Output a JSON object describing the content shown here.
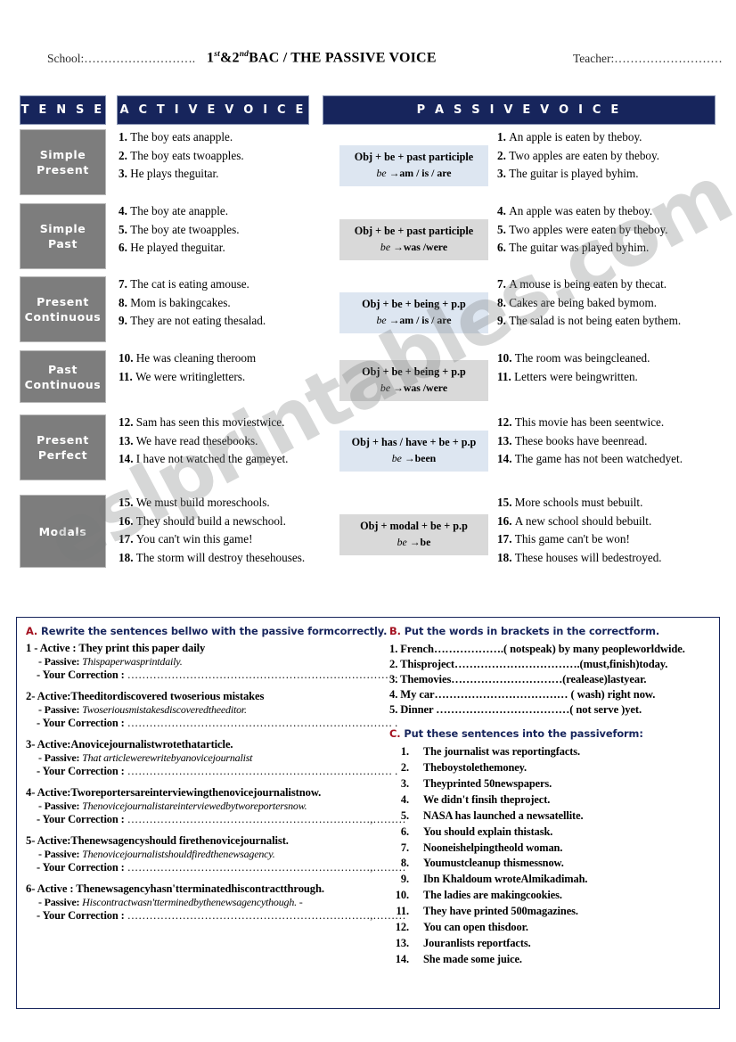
{
  "header": {
    "school_label": "School:……………………….",
    "teacher_label": "Teacher:………………………",
    "title_pre": "1",
    "title_sup1": "st",
    "title_mid": "&2",
    "title_sup2": "nd",
    "title_post": "BAC / THE PASSIVE VOICE",
    "title_plain": "1st&2ndBAC / THE PASSIVE VOICE"
  },
  "columns": {
    "tense": "T E N S E",
    "active": "A C T I V E   V O I C E",
    "passive": "P A S S I V E   V O I C E"
  },
  "colors": {
    "header_navy": "#17255c",
    "tense_gray": "#7d7d7d",
    "formula_blue": "#dde6f1",
    "formula_gray": "#d9d9d9",
    "accent_red": "#a3101f"
  },
  "rows": [
    {
      "tense": "Simple Present",
      "tense_line1": "Simple",
      "tense_line2": "Present",
      "formula_style": "blue",
      "formula_line1": "Obj + be + past participle",
      "formula_line2_pre": "be",
      "formula_line2_post": "am / is / are",
      "active": [
        {
          "n": "1.",
          "text": "The boy  eats anapple."
        },
        {
          "n": "2.",
          "text": "The boy  eats twoapples."
        },
        {
          "n": "3.",
          "text": "He plays  theguitar."
        }
      ],
      "passive": [
        {
          "n": "1.",
          "text": "An apple is eaten by theboy."
        },
        {
          "n": "2.",
          "text": "Two apples are eaten by theboy."
        },
        {
          "n": "3.",
          "text": "The guitar is played byhim."
        }
      ]
    },
    {
      "tense": "Simple Past",
      "tense_line1": "Simple",
      "tense_line2": "Past",
      "formula_style": "gray",
      "formula_line1": "Obj + be + past participle",
      "formula_line2_pre": "be",
      "formula_line2_post": "was /were",
      "active": [
        {
          "n": "4.",
          "text": "The boy  ate anapple."
        },
        {
          "n": "5.",
          "text": "The boy ate twoapples."
        },
        {
          "n": "6.",
          "text": "He  played theguitar."
        }
      ],
      "passive": [
        {
          "n": "4.",
          "text": "An apple was eaten by theboy."
        },
        {
          "n": "5.",
          "text": "Two apples were eaten by theboy."
        },
        {
          "n": "6.",
          "text": "The guitar was played byhim."
        }
      ]
    },
    {
      "tense": "Present Continuous",
      "tense_line1": "Present",
      "tense_line2": "Continuous",
      "formula_style": "blue",
      "formula_line1": "Obj + be + being + p.p",
      "formula_line2_pre": "be",
      "formula_line2_post": "am / is / are",
      "active": [
        {
          "n": "7.",
          "text": "The cat is eating amouse."
        },
        {
          "n": "8.",
          "text": "Mom  is bakingcakes."
        },
        {
          "n": "9.",
          "text": "They  are not eating thesalad."
        }
      ],
      "passive": [
        {
          "n": "7.",
          "text": "A mouse is being  eaten by thecat."
        },
        {
          "n": "8.",
          "text": "Cakes are being baked bymom."
        },
        {
          "n": "9.",
          "text": "The salad  is not being eaten bythem."
        }
      ]
    },
    {
      "tense": "Past Continuous",
      "tense_line1": "Past",
      "tense_line2": "Continuous",
      "formula_style": "gray",
      "formula_line1": "Obj + be + being + p.p",
      "formula_line2_pre": "be",
      "formula_line2_post": "was /were",
      "active": [
        {
          "n": "10.",
          "text": "He  was cleaning theroom"
        },
        {
          "n": "11.",
          "text": "We were writingletters."
        }
      ],
      "passive": [
        {
          "n": "10.",
          "text": "The room was beingcleaned."
        },
        {
          "n": "11.",
          "text": "Letters were beingwritten."
        }
      ]
    },
    {
      "tense": "Present Perfect",
      "tense_line1": "Present",
      "tense_line2": "Perfect",
      "formula_style": "blue",
      "formula_line1": "Obj + has / have + be + p.p",
      "formula_line2_pre": "be",
      "formula_line2_post": "been",
      "active": [
        {
          "n": "12.",
          "text": "Sam has seen this  moviestwice."
        },
        {
          "n": "13.",
          "text": "We  have read thesebooks."
        },
        {
          "n": "14.",
          "text": "I have not watched the  gameyet."
        }
      ],
      "passive": [
        {
          "n": "12.",
          "text": "This movie has been seentwice."
        },
        {
          "n": "13.",
          "text": "These books have beenread."
        },
        {
          "n": "14.",
          "text": "The game has not been watchedyet."
        }
      ]
    },
    {
      "tense": "Modals",
      "tense_line1": "Modals",
      "tense_line2": "",
      "formula_style": "gray",
      "formula_line1": "Obj + modal + be + p.p",
      "formula_line2_pre": "be",
      "formula_line2_post": "be",
      "active": [
        {
          "n": "15.",
          "text": "We  must build moreschools."
        },
        {
          "n": "16.",
          "text": "They should build  a newschool."
        },
        {
          "n": "17.",
          "text": "You  can't win this game!"
        },
        {
          "n": "18.",
          "text": "The storm will destroy thesehouses."
        }
      ],
      "passive": [
        {
          "n": "15.",
          "text": "More schools must  bebuilt."
        },
        {
          "n": "16.",
          "text": "A new school should  bebuilt."
        },
        {
          "n": "17.",
          "text": "This game can't  be won!"
        },
        {
          "n": "18.",
          "text": "These  houses will  bedestroyed."
        }
      ]
    }
  ],
  "exercises": {
    "a": {
      "letter": "A.",
      "title": "Rewrite the sentences bellwo with the passive formcorrectly.",
      "passive_label": "- Passive:",
      "correction_label": "- Your Correction  :",
      "correction_dots": "………………………………………………………………… .",
      "items": [
        {
          "active": "1 - Active : They print this paper daily",
          "passive": "Thispaperwasprintdaily.",
          "correction_dots": "……………………………………………………………… ."
        },
        {
          "active": "2- Active:Theeditordiscovered twoserious mistakes",
          "passive": "Twoseriousmistakesdiscoveredtheeditor.",
          "correction_dots": "……………………………………………………………… ."
        },
        {
          "active": "3- Active:Anovicejournalistwrotethatarticle.",
          "passive": "That articlewerewritebyanovicejournalist",
          "correction_dots": "……………………………………………………………… ."
        },
        {
          "active": "4- Active:Tworeportersareinterviewingthenovicejournalistnow.",
          "passive": "Thenovicejournalistareinterviewedbytworeportersnow.",
          "correction_dots": "…………………………………………………………,………"
        },
        {
          "active": "5- Active:Thenewsagencyshould firethenovicejournalist.",
          "passive": "Thenovicejournalistshouldfiredthenewsagency.",
          "correction_dots": "…………………………………………………………,………"
        },
        {
          "active": "6- Active : Thenewsagencyhasn'tterminatedhiscontractthrough.",
          "passive": "Hiscontractwasn'tterminedbythenewsagencythough.   -",
          "correction_dots": "…………………………………………………………,………"
        }
      ]
    },
    "b": {
      "letter": "B.",
      "title": "Put the words in brackets  in the correctform.",
      "items": [
        {
          "n": "1.",
          "text": "French……………….( notspeak) by many peopleworldwide."
        },
        {
          "n": "2.",
          "text": "Thisproject…………………………….(must,finish)today."
        },
        {
          "n": "3.",
          "text": "Themovies…………………………(realease)lastyear."
        },
        {
          "n": "4.",
          "text": "My car……………………………… ( wash) right now."
        },
        {
          "n": "5.",
          "text": "Dinner ………………………………( not serve )yet."
        }
      ]
    },
    "c": {
      "letter": "C.",
      "title": "Put these sentences into the passiveform:",
      "items": [
        {
          "n": "1.",
          "text": "The journalist was reportingfacts."
        },
        {
          "n": "2.",
          "text": "Theboystolethemoney."
        },
        {
          "n": "3.",
          "text": "Theyprinted 50newspapers."
        },
        {
          "n": "4.",
          "text": "We didn't finsih theproject."
        },
        {
          "n": "5.",
          "text": "NASA has launched a newsatellite."
        },
        {
          "n": "6.",
          "text": "You should explain thistask."
        },
        {
          "n": "7.",
          "text": "Nooneishelpingtheold woman."
        },
        {
          "n": "8.",
          "text": "Youmustcleanup thismessnow."
        },
        {
          "n": "9.",
          "text": "Ibn Khaldoum wroteAlmikadimah."
        },
        {
          "n": "10.",
          "text": "The ladies are makingcookies."
        },
        {
          "n": "11.",
          "text": "They have printed 500magazines."
        },
        {
          "n": "12.",
          "text": "You can open thisdoor."
        },
        {
          "n": "13.",
          "text": "Jouranlists reportfacts."
        },
        {
          "n": "14.",
          "text": "She made some juice."
        }
      ]
    }
  },
  "watermark": "eslprintables.com"
}
